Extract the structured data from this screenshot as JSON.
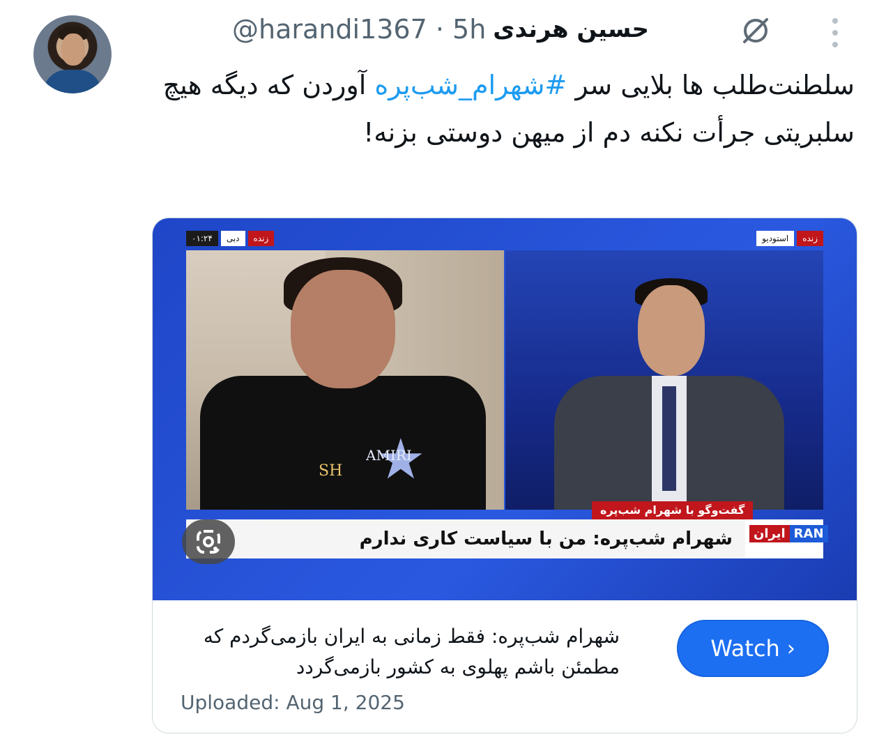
{
  "tweet": {
    "author_name": "حسین هرندی",
    "handle_time": "@harandi1367 · 5h",
    "text_before": "سلطنت‌طلب ها بلایی سر ",
    "hashtag": "#شهرام_شب‌پره",
    "text_after": " آوردن که دیگه هیچ سلبریتی جرأت نکنه دم از میهن دوستی بزنه!"
  },
  "video": {
    "top_left_labels": [
      "۰۱:۲۴",
      "دبی",
      "زنده"
    ],
    "top_right_labels": [
      "استودیو",
      "زنده"
    ],
    "subhead": "گفت‌وگو با شهرام شب‌پره",
    "headline": "شهرام شب‌پره: من با سیاست کاری ندارم",
    "logo_fa": "ایران",
    "logo_en": "RAN",
    "guest_shirt_text": "AMIRI",
    "guest_pendant": "SH"
  },
  "card": {
    "title": "شهرام شب‌پره: فقط زمانی به ایران بازمی‌گردم که مطمئن باشم پهلوی به کشور بازمی‌گردد",
    "uploaded": "Uploaded: Aug 1, 2025",
    "watch_label": "Watch",
    "watch_color": "#1d6ff2"
  },
  "icons": [
    "grok-icon",
    "more-vertical-icon",
    "google-lens-icon",
    "chevron-right-icon"
  ]
}
